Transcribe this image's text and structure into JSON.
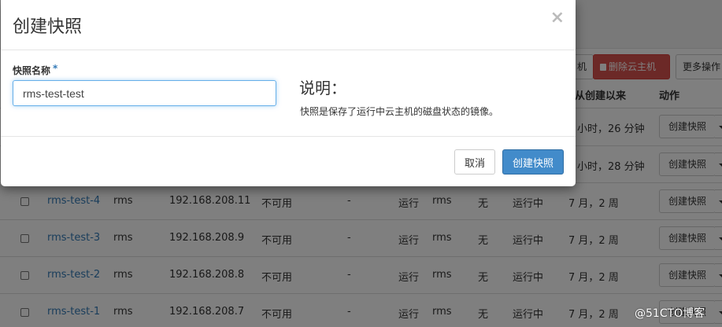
{
  "modal": {
    "title": "创建快照",
    "close_symbol": "×",
    "field_label": "快照名称",
    "required_mark": "*",
    "input_value": "rms-test-test",
    "description_title": "说明：",
    "description_text": "快照是保存了运行中云主机的磁盘状态的镜像。",
    "cancel_label": "取消",
    "submit_label": "创建快照"
  },
  "background": {
    "partial_button": "机",
    "delete_button": "删除云主机",
    "more_button": "更多操作",
    "col_created_partial": "从创建以来",
    "col_actions": "动作",
    "rows": [
      {
        "name": "",
        "project": "",
        "ip": "",
        "size": "",
        "key": "",
        "status": "",
        "zone": "",
        "task": "",
        "power": "",
        "created": "小时，26 分钟",
        "action": "创建快照"
      },
      {
        "name": "",
        "project": "",
        "ip": "",
        "size": "",
        "key": "",
        "status": "",
        "zone": "",
        "task": "",
        "power": "",
        "created": "小时，28 分钟",
        "action": "创建快照"
      },
      {
        "name": "rms-test-4",
        "project": "rms",
        "ip": "192.168.208.11",
        "size": "不可用",
        "key": "-",
        "status": "运行",
        "zone": "rms",
        "task": "无",
        "power": "运行中",
        "created": "7 月，2 周",
        "action": "创建快照"
      },
      {
        "name": "rms-test-3",
        "project": "rms",
        "ip": "192.168.208.9",
        "size": "不可用",
        "key": "-",
        "status": "运行",
        "zone": "rms",
        "task": "无",
        "power": "运行中",
        "created": "7 月，2 周",
        "action": "创建快照"
      },
      {
        "name": "rms-test-2",
        "project": "rms",
        "ip": "192.168.208.8",
        "size": "不可用",
        "key": "-",
        "status": "运行",
        "zone": "rms",
        "task": "无",
        "power": "运行中",
        "created": "7 月，2 周",
        "action": "创建快照"
      },
      {
        "name": "rms-test-1",
        "project": "rms",
        "ip": "192.168.208.7",
        "size": "不可用",
        "key": "-",
        "status": "运行",
        "zone": "rms",
        "task": "无",
        "power": "运行中",
        "created": "7 月，2 周",
        "action": "创建快照"
      }
    ]
  },
  "watermark": "@51CTO博客",
  "colors": {
    "primary": "#428bca",
    "danger": "#d9534f",
    "link": "#337ab7",
    "backdrop": "rgba(0,0,0,0.5)"
  }
}
